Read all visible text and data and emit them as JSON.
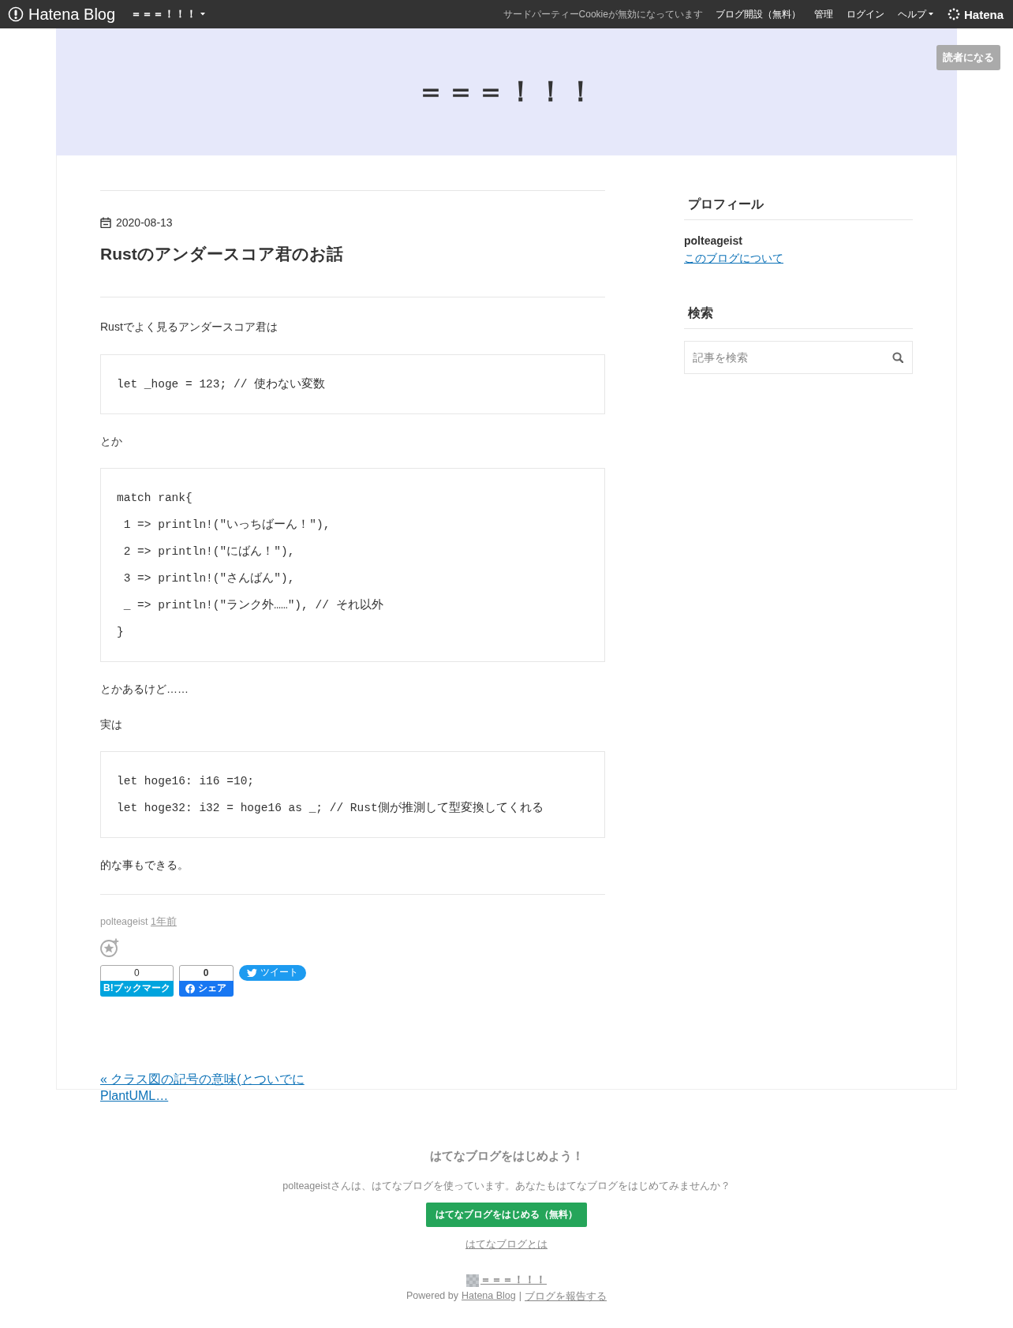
{
  "top_bar": {
    "logo": "Hatena Blog",
    "blog_menu": "＝＝＝！！！",
    "notice": "サードパーティーCookieが無効になっています",
    "links": [
      {
        "label": "ブログ開設（無料）",
        "dropdown": false
      },
      {
        "label": "管理",
        "dropdown": false
      },
      {
        "label": "ログイン",
        "dropdown": false
      },
      {
        "label": "ヘルプ",
        "dropdown": true
      }
    ],
    "brand": "Hatena"
  },
  "header": {
    "title": "＝＝＝！！！",
    "subscribe_button": "読者になる"
  },
  "article": {
    "date": "2020-08-13",
    "title": "Rustのアンダースコア君のお話",
    "body": [
      {
        "kind": "paragraph",
        "text": "Rustでよく見るアンダースコア君は"
      },
      {
        "kind": "code",
        "lines": [
          "let _hoge = 123; // 使わない変数"
        ]
      },
      {
        "kind": "paragraph",
        "text": "とか"
      },
      {
        "kind": "code",
        "lines": [
          "match rank{",
          " 1 => println!(\"いっちばーん！\"),",
          " 2 => println!(\"にばん！\"),",
          " 3 => println!(\"さんばん\"),",
          " _ => println!(\"ランク外……\"), // それ以外",
          "}"
        ]
      },
      {
        "kind": "paragraph",
        "text": "とかあるけど……"
      },
      {
        "kind": "paragraph",
        "text": "実は"
      },
      {
        "kind": "code",
        "lines": [
          "let hoge16: i16 =10;",
          "let hoge32: i32 = hoge16 as _; // Rust側が推測して型変換してくれる"
        ]
      },
      {
        "kind": "paragraph",
        "text": "的な事もできる。"
      }
    ],
    "author": "polteageist",
    "time": "1年前",
    "share": {
      "bookmark_count": "0",
      "bookmark_label": "B!ブックマーク",
      "facebook_count": "0",
      "facebook_label": "シェア",
      "tweet_label": "ツイート"
    }
  },
  "pager": {
    "previous": "« クラス図の記号の意味(とついでにPlantUML…"
  },
  "sidebar": {
    "modules": [
      {
        "kind": "profile",
        "title": "プロフィール",
        "name": "polteageist",
        "link": "このブログについて"
      },
      {
        "kind": "search",
        "title": "検索",
        "placeholder": "記事を検索"
      }
    ]
  },
  "footer": {
    "heading": "はてなブログをはじめよう！",
    "text": "polteageistさんは、はてなブログを使っています。あなたもはてなブログをはじめてみませんか？",
    "button": "はてなブログをはじめる（無料）",
    "about_link": "はてなブログとは",
    "blog_link": "＝＝＝！！！",
    "powered_by": "Powered by",
    "powered_link": "Hatena Blog",
    "separator": "|",
    "report_link": "ブログを報告する"
  }
}
